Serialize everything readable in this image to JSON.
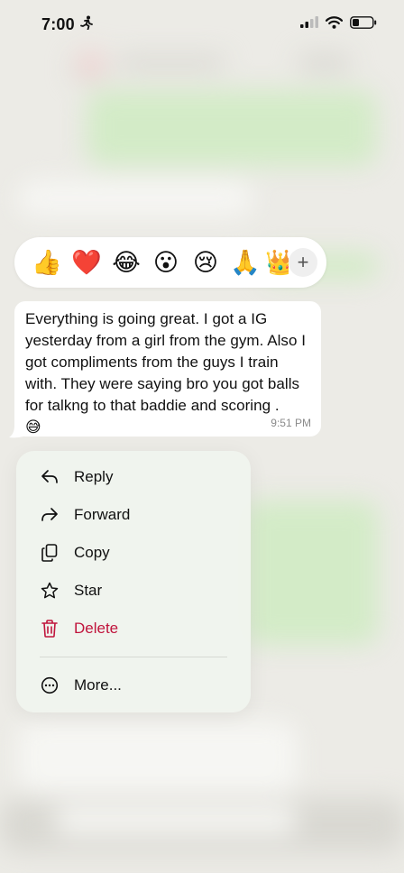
{
  "status_bar": {
    "time": "7:00",
    "activity_icon": "running-figure-icon",
    "signal_icon": "cellular-signal-icon",
    "wifi_icon": "wifi-icon",
    "battery_icon": "battery-icon"
  },
  "reactions": [
    {
      "name": "thumbs-up",
      "glyph": "👍"
    },
    {
      "name": "red-heart",
      "glyph": "❤️"
    },
    {
      "name": "tears-of-joy",
      "glyph": "😂"
    },
    {
      "name": "surprised-face",
      "glyph": "😮"
    },
    {
      "name": "crying-face",
      "glyph": "😢"
    },
    {
      "name": "folded-hands",
      "glyph": "🙏"
    },
    {
      "name": "partial-emoji",
      "glyph": "👑"
    }
  ],
  "reaction_more": "+",
  "message": {
    "text": "Everything is going great. I got a IG yesterday from a girl from the gym. Also I got compliments from the guys I train with. They were saying bro you got balls for talkng to that baddie and scoring .",
    "emoji": "😅",
    "time": "9:51 PM"
  },
  "menu": {
    "reply": "Reply",
    "forward": "Forward",
    "copy": "Copy",
    "star": "Star",
    "delete": "Delete",
    "more": "More..."
  },
  "colors": {
    "delete": "#c0143c",
    "background": "#ecebe6",
    "bubble": "#ffffff"
  }
}
